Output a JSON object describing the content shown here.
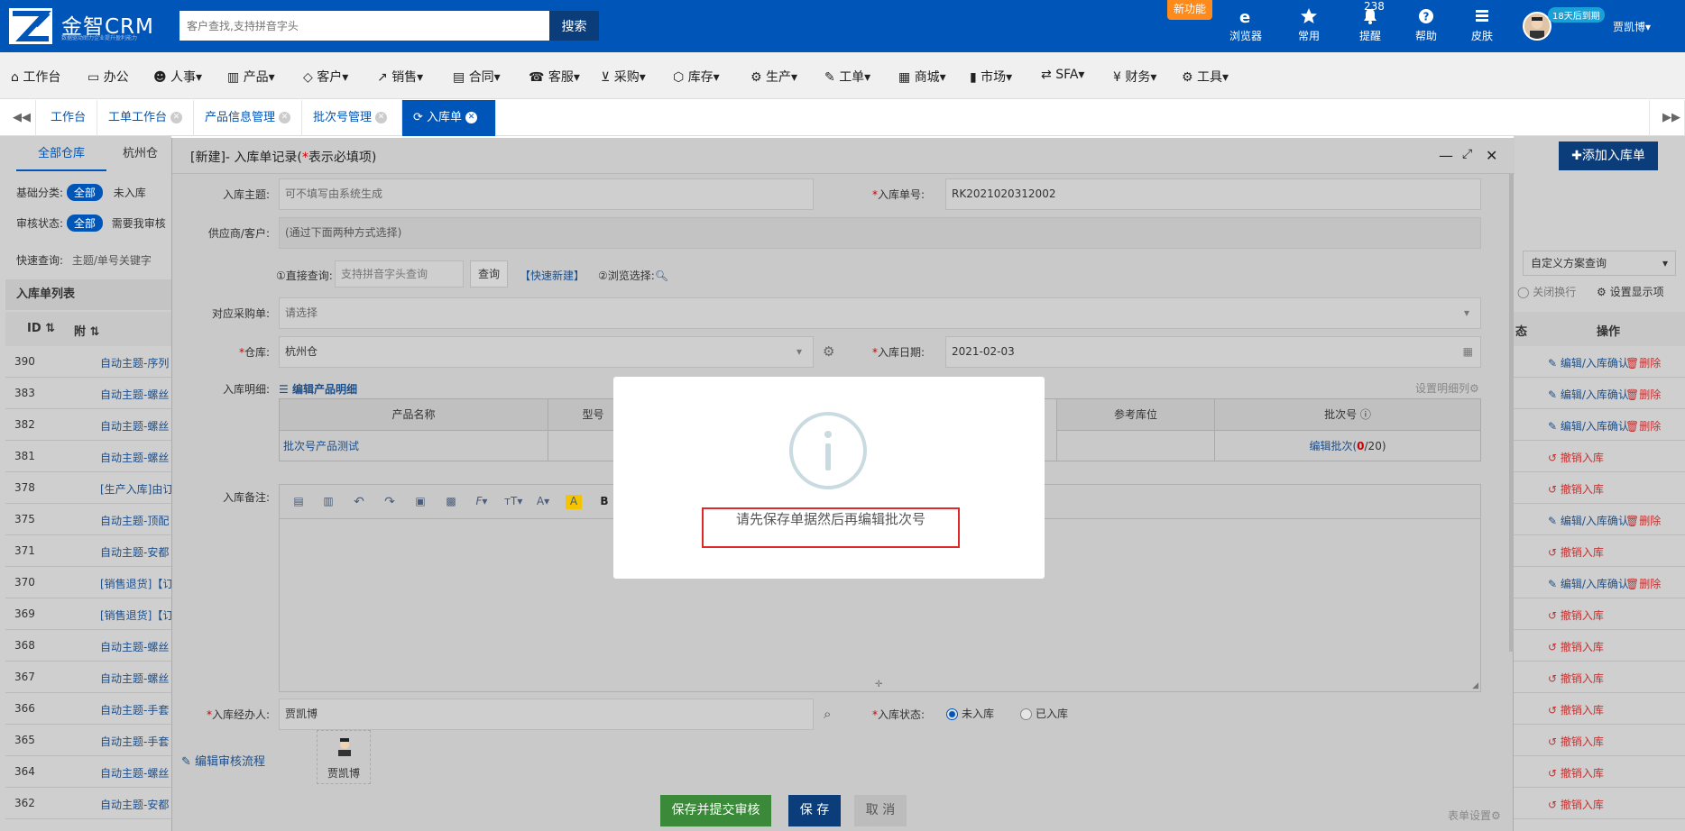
{
  "header": {
    "brand": "金智CRM",
    "slogan": "数据驱动助力企业提升盈利能力",
    "search_placeholder": "客户查找,支持拼音字头",
    "search_button": "搜索",
    "new_feature": "新功能",
    "tools": [
      {
        "label": "浏览器",
        "icon": "ie-browser-icon"
      },
      {
        "label": "常用",
        "icon": "star-icon"
      },
      {
        "label": "提醒",
        "icon": "bell-icon"
      },
      {
        "label": "帮助",
        "icon": "question-icon"
      },
      {
        "label": "皮肤",
        "icon": "skin-icon"
      }
    ],
    "reminder_count": "238",
    "trial_badge": "18天后到期",
    "user": "贾凯博▾"
  },
  "nav": {
    "items": [
      "工作台",
      "办公",
      "人事▾",
      "产品▾",
      "客户▾",
      "销售▾",
      "合同▾",
      "客服▾",
      "采购▾",
      "库存▾",
      "生产▾",
      "工单▾",
      "商城▾",
      "市场▾",
      "SFA▾",
      "¥ 财务▾",
      "工具▾"
    ]
  },
  "tabs": {
    "items": [
      "工作台",
      "工单工作台",
      "产品信息管理",
      "批次号管理",
      "入库单"
    ]
  },
  "background": {
    "tab_all": "全部仓库",
    "tab_hz": "杭州仓",
    "basic_label": "基础分类:",
    "basic_all": "全部",
    "basic_not_in": "未入库",
    "audit_label": "审核状态:",
    "audit_all": "全部",
    "audit_need": "需要我审核",
    "quick_label": "快速查询:",
    "quick_placeholder": "主题/单号关键字",
    "list_title": "入库单列表",
    "col_id": "ID",
    "col_attach": "附",
    "rows": [
      {
        "id": "390",
        "title": "自动主题-序列"
      },
      {
        "id": "383",
        "title": "自动主题-螺丝"
      },
      {
        "id": "382",
        "title": "自动主题-螺丝"
      },
      {
        "id": "381",
        "title": "自动主题-螺丝"
      },
      {
        "id": "378",
        "title": "[生产入库]由订"
      },
      {
        "id": "375",
        "title": "自动主题-顶配"
      },
      {
        "id": "371",
        "title": "自动主题-安都"
      },
      {
        "id": "370",
        "title": "[销售退货]【订"
      },
      {
        "id": "369",
        "title": "[销售退货]【订"
      },
      {
        "id": "368",
        "title": "自动主题-螺丝"
      },
      {
        "id": "367",
        "title": "自动主题-螺丝"
      },
      {
        "id": "366",
        "title": "自动主题-手套"
      },
      {
        "id": "365",
        "title": "自动主题-手套"
      },
      {
        "id": "364",
        "title": "自动主题-螺丝"
      },
      {
        "id": "362",
        "title": "自动主题-安都"
      }
    ],
    "add_button": "✚添加入库单",
    "custom_query": "自定义方案查询",
    "close_wrap": "关闭换行",
    "set_display": "设置显示项",
    "col_state": "态",
    "col_ops": "操作",
    "ops": [
      {
        "a": "编辑/入库确认",
        "b": "删除"
      },
      {
        "a": "编辑/入库确认",
        "b": "删除"
      },
      {
        "a": "编辑/入库确认",
        "b": "删除"
      },
      {
        "a": "撤销入库",
        "b": ""
      },
      {
        "a": "撤销入库",
        "b": ""
      },
      {
        "a": "编辑/入库确认",
        "b": "删除"
      },
      {
        "a": "撤销入库",
        "b": ""
      },
      {
        "a": "编辑/入库确认",
        "b": "删除"
      },
      {
        "a": "撤销入库",
        "b": ""
      },
      {
        "a": "撤销入库",
        "b": ""
      },
      {
        "a": "撤销入库",
        "b": ""
      },
      {
        "a": "撤销入库",
        "b": ""
      },
      {
        "a": "撤销入库",
        "b": ""
      },
      {
        "a": "撤销入库",
        "b": ""
      },
      {
        "a": "撤销入库",
        "b": ""
      }
    ]
  },
  "form": {
    "title_prefix": "[新建]- 入库单记录(",
    "title_star": "*",
    "title_suffix": "表示必填项)",
    "subject_label": "入库主题:",
    "subject_placeholder": "可不填写由系统生成",
    "number_label": "入库单号:",
    "number_value": "RK2021020312002",
    "supplier_label": "供应商/客户:",
    "supplier_placeholder": "(通过下面两种方式选择)",
    "direct_query": "①直接查询:",
    "direct_placeholder": "支持拼音字头查询",
    "query_button": "查询",
    "quick_new": "【快速新建】",
    "browse_select": "②浏览选择:",
    "po_label": "对应采购单:",
    "po_placeholder": "请选择",
    "warehouse_label": "仓库:",
    "warehouse_value": "杭州仓",
    "date_label": "入库日期:",
    "date_value": "2021-02-03",
    "detail_label": "入库明细:",
    "edit_products": "编辑产品明细",
    "detail_settings": "设置明细列",
    "col_product": "产品名称",
    "col_model": "型号",
    "col_location": "参考库位",
    "col_batch": "批次号",
    "product_row_name": "批次号产品测试",
    "batch_edit": "编辑批次(",
    "batch_count": "0",
    "batch_total": "/20)",
    "remark_label": "入库备注:",
    "handler_label": "入库经办人:",
    "handler_value": "贾凯博",
    "status_label": "入库状态:",
    "status_not_in": "未入库",
    "status_in": "已入库",
    "audit_flow": "编辑审核流程",
    "auditor_name": "贾凯博",
    "save_submit": "保存并提交审核",
    "save": "保 存",
    "cancel": "取 消",
    "form_settings": "表单设置"
  },
  "dialog": {
    "message": "请先保存单据然后再编辑批次号"
  }
}
